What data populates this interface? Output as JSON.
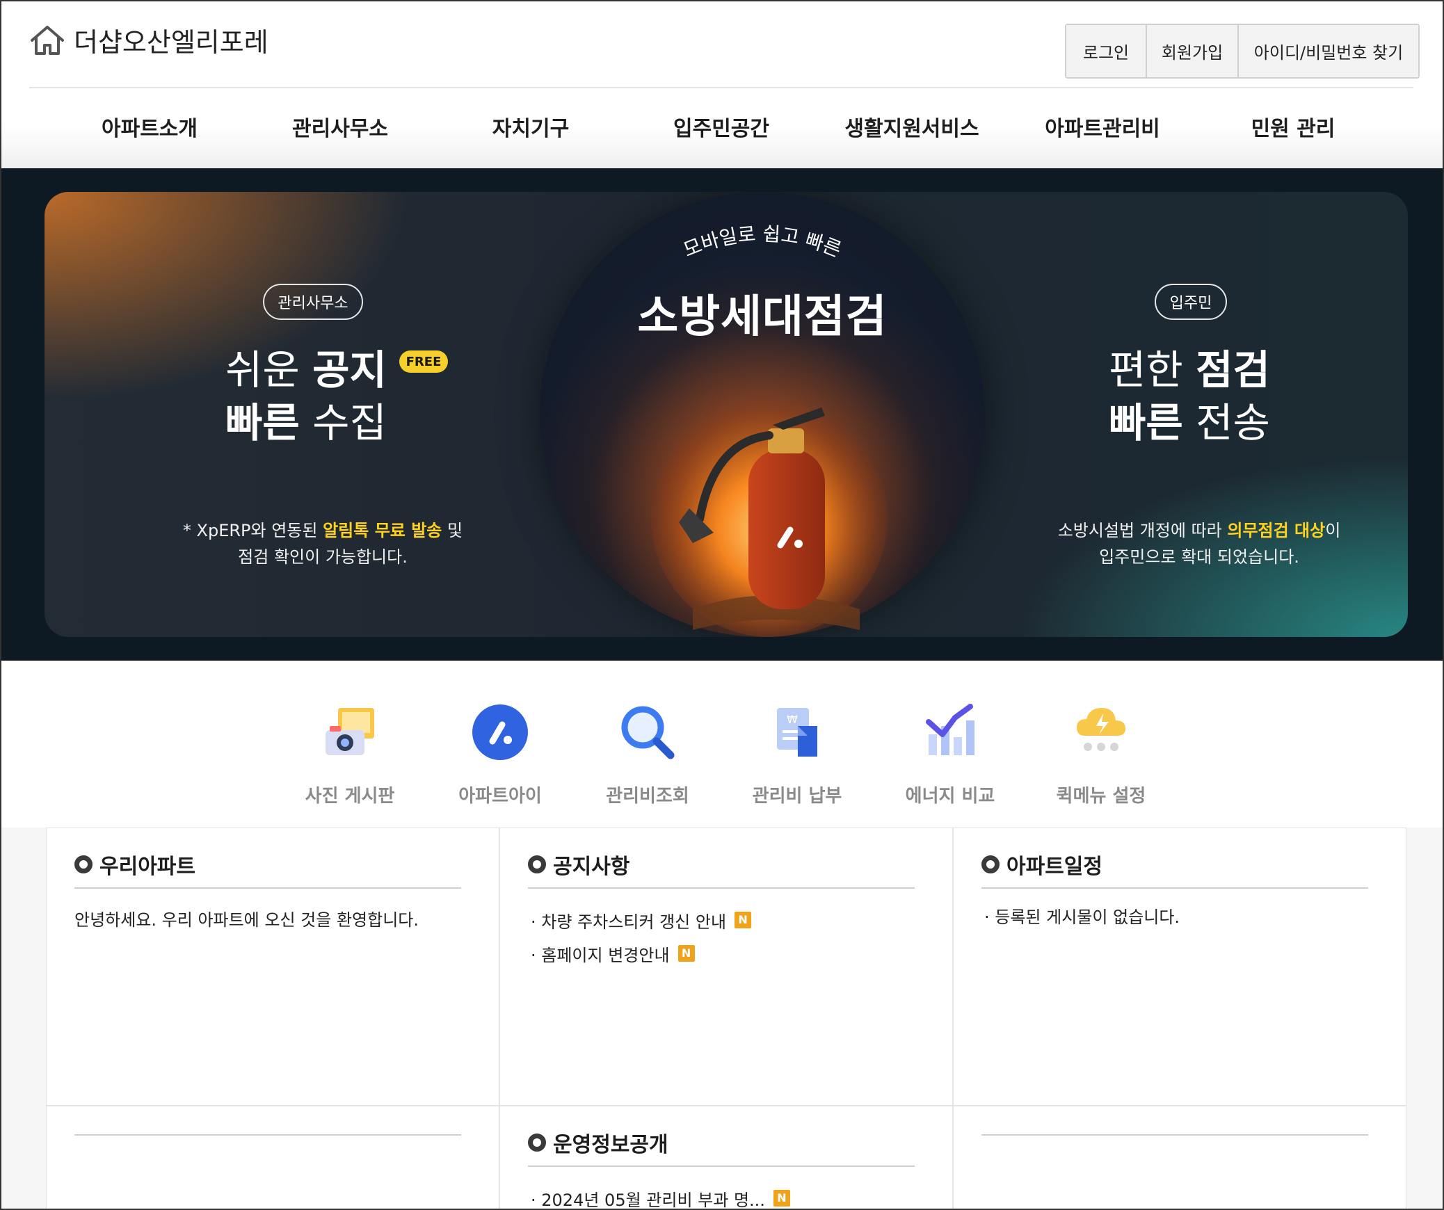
{
  "header": {
    "site_title": "더샵오산엘리포레",
    "auth": [
      "로그인",
      "회원가입",
      "아이디/비밀번호 찾기"
    ],
    "nav": [
      "아파트소개",
      "관리사무소",
      "자치기구",
      "입주민공간",
      "생활지원서비스",
      "아파트관리비",
      "민원 관리"
    ]
  },
  "banner": {
    "left": {
      "pill": "관리사무소",
      "line1_light": "쉬운 ",
      "line1_bold": "공지",
      "badge": "FREE",
      "line2_bold": "빠른",
      "line2_light": " 수집",
      "desc_prefix": "* XpERP와 연동된 ",
      "desc_highlight": "알림톡 무료 발송",
      "desc_suffix": " 및",
      "desc_line2": "점검 확인이 가능합니다."
    },
    "center": {
      "arc_text": "모바일로 쉽고 빠른",
      "title": "소방세대점검"
    },
    "right": {
      "pill": "입주민",
      "line1_light": "편한 ",
      "line1_bold": "점검",
      "line2_bold": "빠른",
      "line2_light": " 전송",
      "desc_prefix": "소방시설법 개정에 따라 ",
      "desc_highlight": "의무점검 대상",
      "desc_suffix": "이",
      "desc_line2": "입주민으로 확대 되었습니다."
    }
  },
  "quick_menu": [
    {
      "label": "사진 게시판",
      "icon": "camera-photo-icon"
    },
    {
      "label": "아파트아이",
      "icon": "aptai-logo-icon"
    },
    {
      "label": "관리비조회",
      "icon": "magnifier-icon"
    },
    {
      "label": "관리비 납부",
      "icon": "bill-payment-icon"
    },
    {
      "label": "에너지 비교",
      "icon": "energy-chart-icon"
    },
    {
      "label": "퀵메뉴 설정",
      "icon": "cloud-settings-icon"
    }
  ],
  "panels": {
    "our_apt": {
      "title": "우리아파트",
      "text": "안녕하세요. 우리 아파트에 오신 것을 환영합니다."
    },
    "notice": {
      "title": "공지사항",
      "items": [
        "· 차량 주차스티커 갱신 안내",
        "· 홈페이지 변경안내"
      ],
      "badge": "N"
    },
    "schedule": {
      "title": "아파트일정",
      "text": "· 등록된 게시물이 없습니다."
    },
    "disclosure": {
      "title": "운영정보공개",
      "items": [
        "· 2024년 05월 관리비 부과 명..."
      ],
      "badge": "N"
    }
  },
  "colors": {
    "accent_yellow": "#ffd21f",
    "badge_orange": "#f0a21a",
    "banner_bg": "#0e1a23"
  }
}
